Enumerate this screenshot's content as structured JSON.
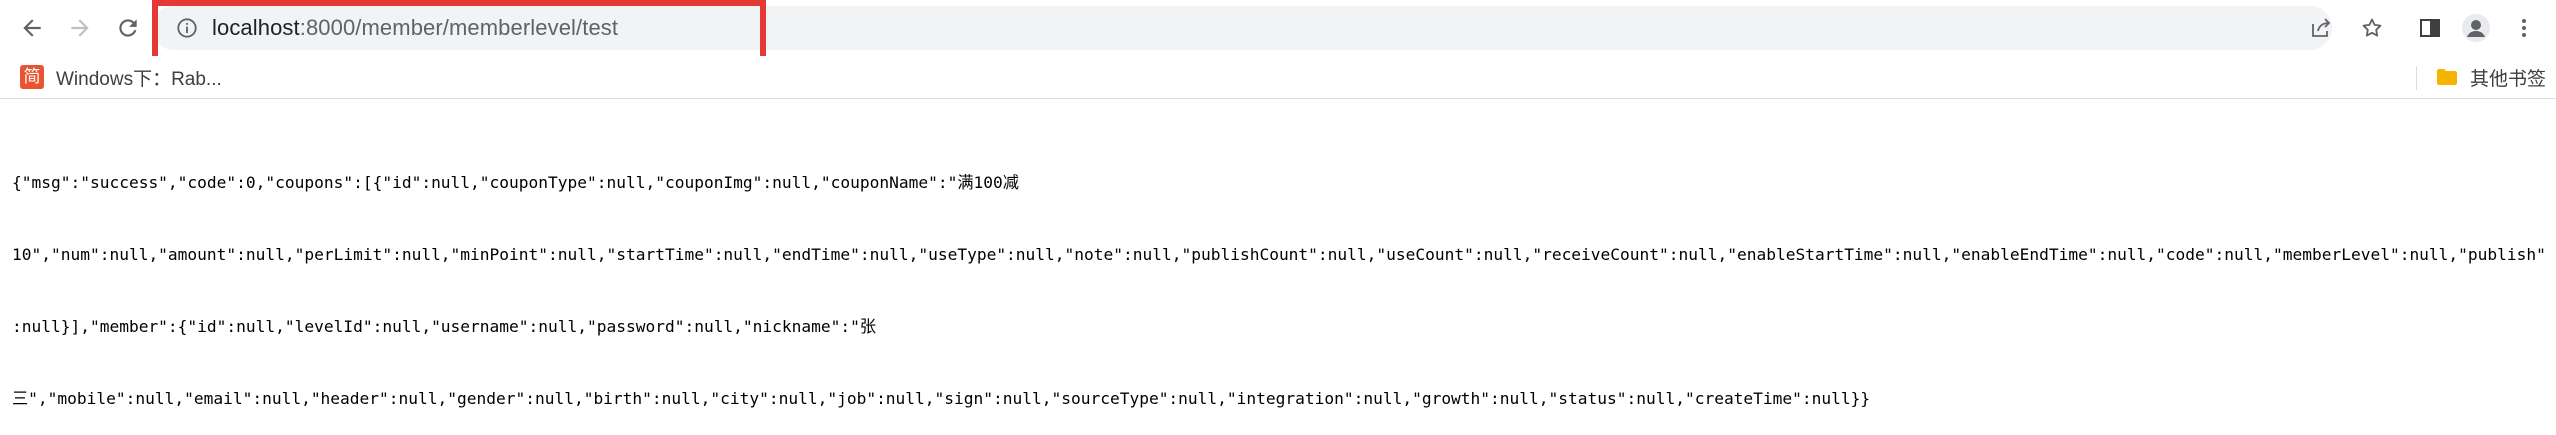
{
  "browser": {
    "nav": {
      "back_icon": "arrow-left-icon",
      "forward_icon": "arrow-right-icon",
      "reload_icon": "reload-icon"
    },
    "address_bar": {
      "host": "localhost",
      "path": ":8000/member/memberlevel/test",
      "info_icon": "info-circle-icon"
    },
    "toolbar_icons": [
      "share-icon",
      "star-icon",
      "side-panel-icon",
      "profile-icon",
      "more-vertical-icon"
    ]
  },
  "bookmarks": {
    "items": [
      {
        "label": "Windows下：Rab...",
        "favicon_char": "简",
        "favicon_color": "#e8542f"
      }
    ],
    "other_folder": {
      "label": "其他书签",
      "folder_color": "#f4b400"
    }
  },
  "page": {
    "lines": [
      "{\"msg\":\"success\",\"code\":0,\"coupons\":[{\"id\":null,\"couponType\":null,\"couponImg\":null,\"couponName\":\"满100减",
      "10\",\"num\":null,\"amount\":null,\"perLimit\":null,\"minPoint\":null,\"startTime\":null,\"endTime\":null,\"useType\":null,\"note\":null,\"publishCount\":null,\"useCount\":null,\"receiveCount\":null,\"enableStartTime\":null,\"enableEndTime\":null,\"code\":null,\"memberLevel\":null,\"publish\"",
      ":null}],\"member\":{\"id\":null,\"levelId\":null,\"username\":null,\"password\":null,\"nickname\":\"张",
      "三\",\"mobile\":null,\"email\":null,\"header\":null,\"gender\":null,\"birth\":null,\"city\":null,\"job\":null,\"sign\":null,\"sourceType\":null,\"integration\":null,\"growth\":null,\"status\":null,\"createTime\":null}}"
    ]
  },
  "colors": {
    "highlight_border": "#e53935",
    "omnibox_bg": "#f1f3f4"
  }
}
